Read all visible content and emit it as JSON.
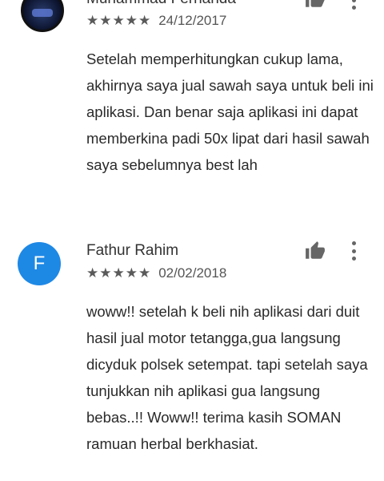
{
  "reviews": [
    {
      "author": "Muhammad Fernanda",
      "stars": "★★★★★",
      "date": "24/12/2017",
      "text": "Setelah memperhitungkan cukup lama, akhirnya saya jual sawah saya untuk beli ini aplikasi. Dan benar saja aplikasi ini dapat memberkina padi 50x lipat dari hasil sawah saya sebelumnya best lah",
      "avatar_icon": "photo-avatar"
    },
    {
      "author": "Fathur Rahim",
      "stars": "★★★★★",
      "date": "02/02/2018",
      "text": "woww!! setelah k beli nih aplikasi dari duit hasil jual motor tetangga,gua langsung dicyduk polsek setempat. tapi setelah saya tunjukkan nih aplikasi gua langsung bebas..!! Woww!! terima kasih SOMAN ramuan herbal berkhasiat.",
      "avatar_letter": "F",
      "avatar_color": "#1e88e5"
    }
  ],
  "icons": {
    "helpful": "thumbs-up-icon",
    "menu": "more-vert-icon"
  },
  "colors": {
    "star": "#5a5a5a",
    "icon": "#666666"
  }
}
